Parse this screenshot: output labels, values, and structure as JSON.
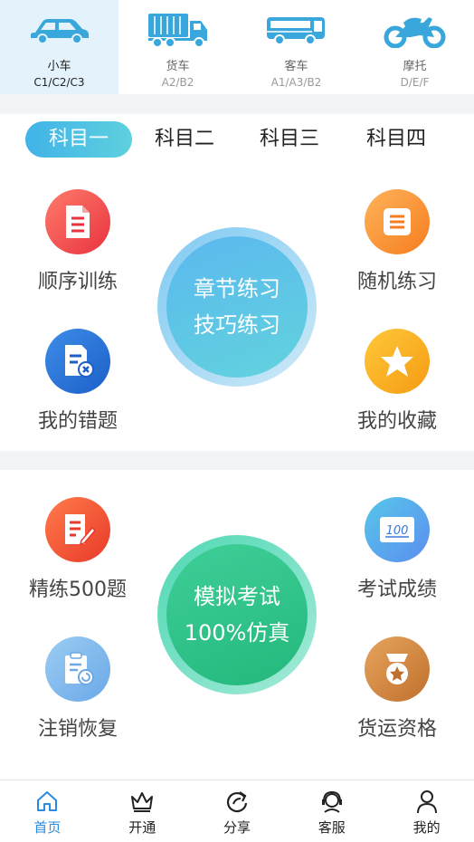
{
  "vehicles": [
    {
      "name": "小车",
      "code": "C1/C2/C3",
      "icon": "car-icon",
      "active": true
    },
    {
      "name": "货车",
      "code": "A2/B2",
      "icon": "truck-icon",
      "active": false
    },
    {
      "name": "客车",
      "code": "A1/A3/B2",
      "icon": "bus-icon",
      "active": false
    },
    {
      "name": "摩托",
      "code": "D/E/F",
      "icon": "motorcycle-icon",
      "active": false
    }
  ],
  "subject_tabs": [
    "科目一",
    "科目二",
    "科目三",
    "科目四"
  ],
  "practice": {
    "sequential": "顺序训练",
    "random": "随机练习",
    "wrong": "我的错题",
    "favorites": "我的收藏",
    "center_line1": "章节练习",
    "center_line2": "技巧练习"
  },
  "exam": {
    "selected500": "精练500题",
    "scores": "考试成绩",
    "cancel_restore": "注销恢复",
    "freight": "货运资格",
    "center_line1": "模拟考试",
    "center_line2": "100%仿真"
  },
  "tabbar": [
    {
      "label": "首页",
      "icon": "home-icon",
      "active": true
    },
    {
      "label": "开通",
      "icon": "crown-icon",
      "active": false
    },
    {
      "label": "分享",
      "icon": "share-icon",
      "active": false
    },
    {
      "label": "客服",
      "icon": "customer-service-icon",
      "active": false
    },
    {
      "label": "我的",
      "icon": "user-icon",
      "active": false
    }
  ],
  "colors": {
    "accent": "#40b3e8",
    "vehicle_icon": "#3aa7dc",
    "active_tab_text": "#2a8be0"
  }
}
